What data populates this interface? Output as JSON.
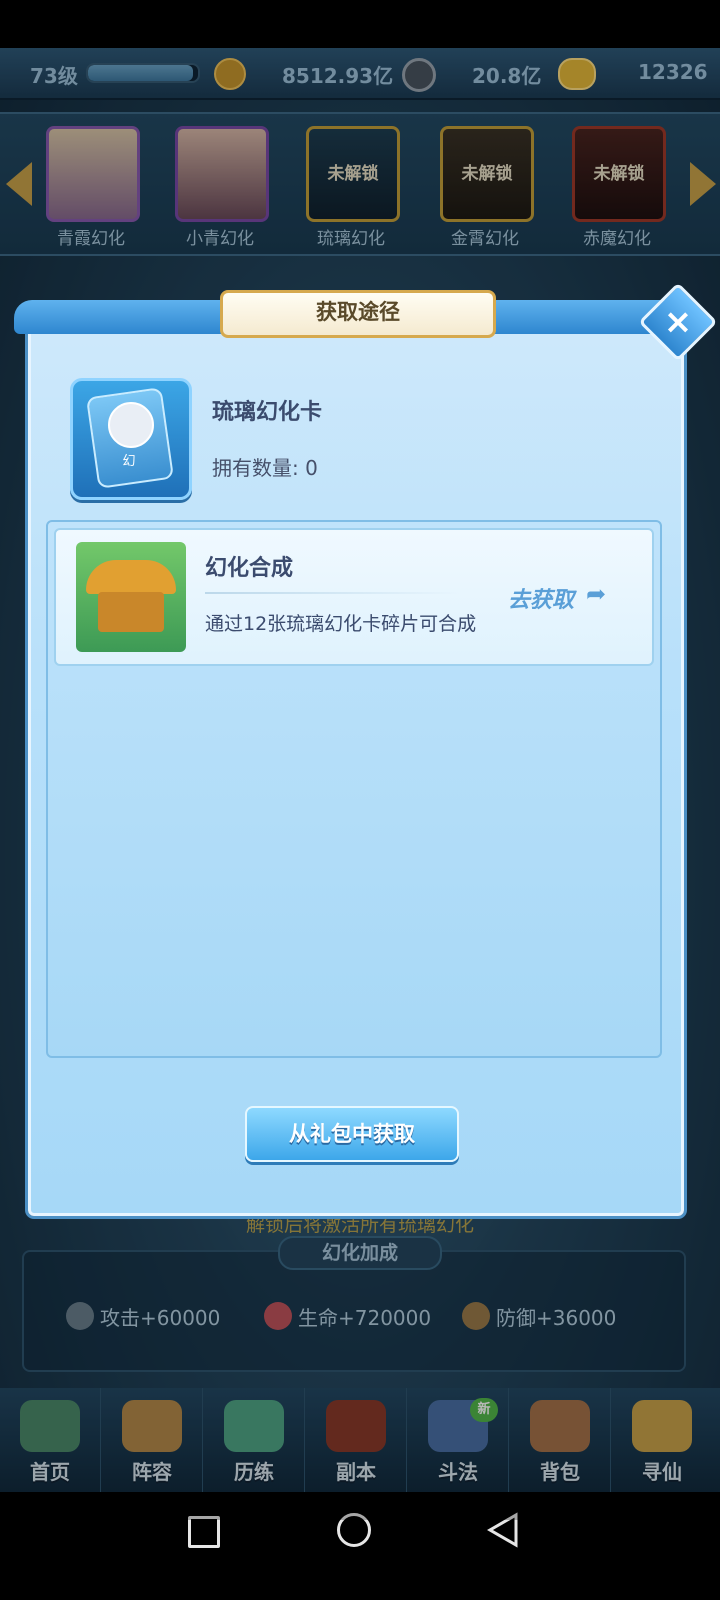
{
  "currency_bar": {
    "level": "73级",
    "exp_fraction": 0.95,
    "power_value": "8512.93亿",
    "silver_value": "20.8亿",
    "gold_value": "12326"
  },
  "skins": [
    {
      "label": "青霞幻化",
      "lock_text": ""
    },
    {
      "label": "小青幻化",
      "lock_text": ""
    },
    {
      "label": "琉璃幻化",
      "lock_text": "未解锁"
    },
    {
      "label": "金霄幻化",
      "lock_text": "未解锁"
    },
    {
      "label": "赤魔幻化",
      "lock_text": "未解锁"
    }
  ],
  "modal": {
    "title": "获取途径",
    "item_name": "琉璃幻化卡",
    "item_glyph": "幻",
    "owned_label": "拥有数量:",
    "owned_count": "0",
    "sources": [
      {
        "title": "幻化合成",
        "description": "通过12张琉璃幻化卡碎片可合成",
        "action_label": "去获取"
      }
    ],
    "gift_button_label": "从礼包中获取"
  },
  "background_panel": {
    "unlock_hint": "解锁后将激活所有琉璃幻化",
    "bonus_title": "幻化加成",
    "bonuses": [
      {
        "label": "攻击+60000"
      },
      {
        "label": "生命+720000"
      },
      {
        "label": "防御+36000"
      }
    ]
  },
  "bottom_nav": {
    "items": [
      {
        "label": "首页"
      },
      {
        "label": "阵容"
      },
      {
        "label": "历练"
      },
      {
        "label": "副本"
      },
      {
        "label": "斗法"
      },
      {
        "label": "背包"
      },
      {
        "label": "寻仙"
      }
    ],
    "new_badge": "新"
  },
  "colors": {
    "accent_blue": "#3da7ea",
    "title_gold": "#d6a94e",
    "bonus_text": "#b9a24e"
  },
  "icons": {
    "power": "zhan-badge-icon",
    "silver": "copper-coin-icon",
    "gold": "gold-ingot-icon",
    "close": "close-icon",
    "goto": "share-arrow-icon"
  }
}
